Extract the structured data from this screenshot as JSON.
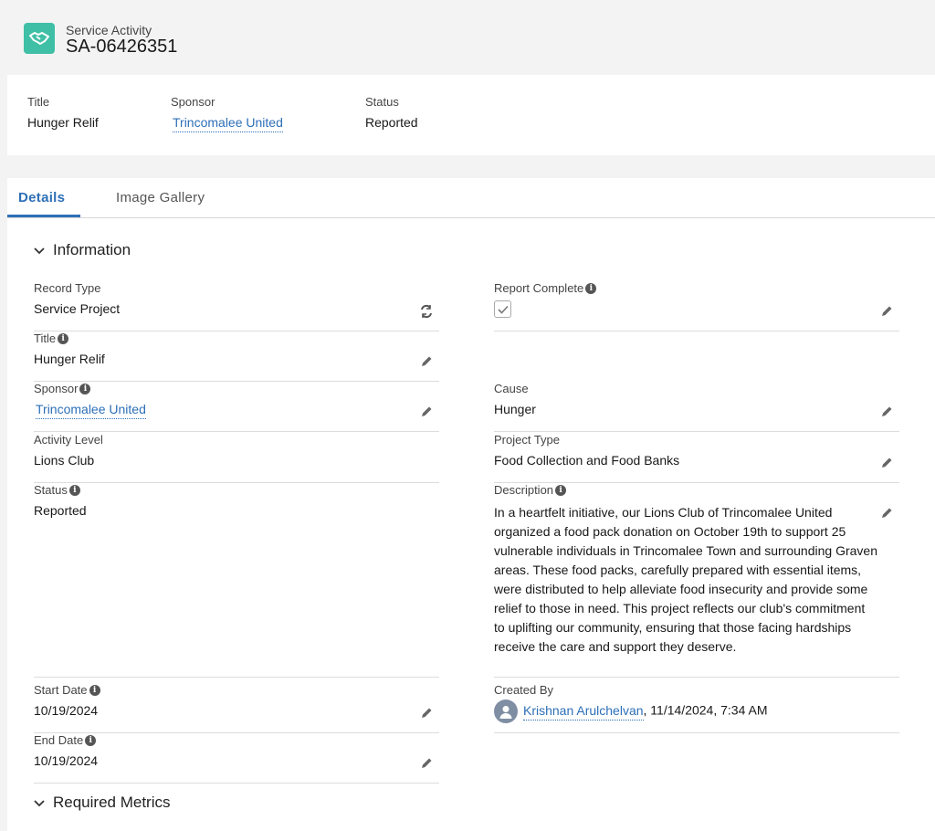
{
  "header": {
    "object_label": "Service Activity",
    "record_name": "SA-06426351"
  },
  "highlights": [
    {
      "label": "Title",
      "value": "Hunger Relif"
    },
    {
      "label": "Sponsor",
      "value": "Trincomalee United"
    },
    {
      "label": "Status",
      "value": "Reported"
    }
  ],
  "tabs": {
    "details": "Details",
    "gallery": "Image Gallery"
  },
  "sections": {
    "information": "Information",
    "required_metrics": "Required Metrics"
  },
  "fields": {
    "record_type": {
      "label": "Record Type",
      "value": "Service Project"
    },
    "title": {
      "label": "Title",
      "value": "Hunger Relif"
    },
    "sponsor": {
      "label": "Sponsor",
      "value": "Trincomalee United"
    },
    "activity_level": {
      "label": "Activity Level",
      "value": "Lions Club"
    },
    "status": {
      "label": "Status",
      "value": "Reported"
    },
    "start_date": {
      "label": "Start Date",
      "value": "10/19/2024"
    },
    "end_date": {
      "label": "End Date",
      "value": "10/19/2024"
    },
    "report_complete": {
      "label": "Report Complete",
      "checked": true
    },
    "cause": {
      "label": "Cause",
      "value": "Hunger"
    },
    "project_type": {
      "label": "Project Type",
      "value": "Food Collection and Food Banks"
    },
    "description": {
      "label": "Description",
      "value": "In a heartfelt initiative, our Lions Club of Trincomalee United organized a food pack donation on October 19th to support 25 vulnerable individuals in Trincomalee Town and surrounding Graven areas. These food packs, carefully prepared with essential items, were distributed to help alleviate food insecurity and provide some relief to those in need. This project reflects our club's commitment to uplifting our community, ensuring that those facing hardships receive the care and support they deserve."
    },
    "created_by": {
      "label": "Created By",
      "user": "Krishnan Arulchelvan",
      "datetime": ", 11/14/2024, 7:34 AM"
    }
  },
  "colors": {
    "accent": "#2d6fb7",
    "icon_bg": "#3ebfa6"
  }
}
